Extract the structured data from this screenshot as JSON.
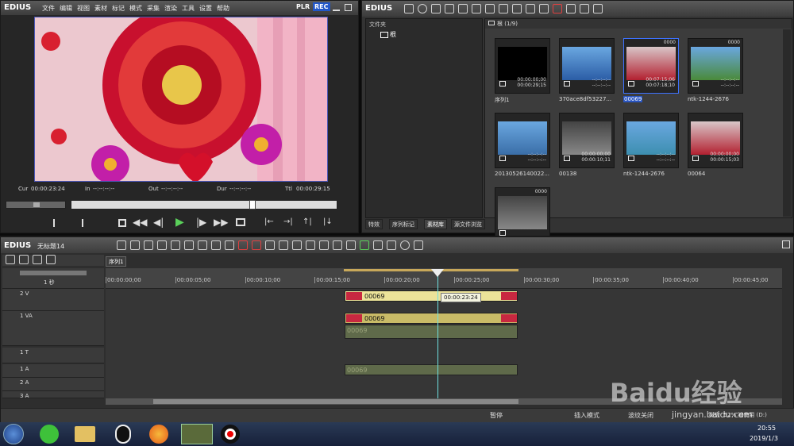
{
  "player": {
    "brand": "EDIUS",
    "menu": [
      "文件",
      "编辑",
      "视图",
      "素材",
      "标记",
      "模式",
      "采集",
      "渲染",
      "工具",
      "设置",
      "帮助"
    ],
    "plr": "PLR",
    "rec": "REC",
    "cur_label": "Cur",
    "cur_value": "00:00:23:24",
    "in_label": "In",
    "in_value": "--:--:--:--",
    "out_label": "Out",
    "out_value": "--:--:--:--",
    "dur_label": "Dur",
    "dur_value": "--:--:--:--",
    "ttl_label": "Ttl",
    "ttl_value": "00:00:29:15",
    "scrub_position": 0.68
  },
  "bin": {
    "brand": "EDIUS",
    "folder_header": "文件夹",
    "root_label": "根",
    "path_label": "根 (1/9)",
    "clips": [
      {
        "name": "序列1",
        "tc1": "00:00:00;00",
        "tc2": "00:00:29;15",
        "type": "sequence",
        "selected": false,
        "badge": ""
      },
      {
        "name": "370ace8df53227...",
        "tc1": "--:--:--:--",
        "tc2": "--:--:--:--",
        "type": "photo",
        "selected": false,
        "badge": ""
      },
      {
        "name": "00069",
        "tc1": "00:07:15;06",
        "tc2": "00:07:18;10",
        "type": "video",
        "selected": true,
        "badge": "0000"
      },
      {
        "name": "ntk-1244-2676",
        "tc1": "--:--:--:--",
        "tc2": "--:--:--:--",
        "type": "photo",
        "selected": false,
        "badge": "0000"
      },
      {
        "name": "20130526140022...",
        "tc1": "--:--:--:--",
        "tc2": "--:--:--:--",
        "type": "photo",
        "selected": false,
        "badge": ""
      },
      {
        "name": "00138",
        "tc1": "00:00:00;00",
        "tc2": "00:00:10;11",
        "type": "video",
        "selected": false,
        "badge": ""
      },
      {
        "name": "ntk-1244-2676",
        "tc1": "--:--:--:--",
        "tc2": "--:--:--:--",
        "type": "video",
        "selected": false,
        "badge": ""
      },
      {
        "name": "00064",
        "tc1": "00:00:00;00",
        "tc2": "00:00:15;03",
        "type": "video",
        "selected": false,
        "badge": ""
      },
      {
        "name": "",
        "tc1": "",
        "tc2": "",
        "type": "video",
        "selected": false,
        "badge": "0000"
      }
    ],
    "tabs": [
      "特效",
      "序列标记",
      "素材库",
      "源文件浏览"
    ]
  },
  "timeline": {
    "brand": "EDIUS",
    "project_name": "无标题14",
    "sequence_tab": "序列1",
    "zoom_label": "1 秒",
    "ruler": [
      "00:00:00;00",
      "00:00:05;00",
      "00:00:10;00",
      "00:00:15;00",
      "00:00:20;00",
      "00:00:25;00",
      "00:00:30;00",
      "00:00:35;00",
      "00:00:40;00",
      "00:00:45;00"
    ],
    "tracks": [
      {
        "name": "2 V"
      },
      {
        "name": "1 VA"
      },
      {
        "name": "1 T"
      },
      {
        "name": "1 A"
      },
      {
        "name": "2 A"
      },
      {
        "name": "3 A"
      }
    ],
    "clip_label": "00069",
    "playhead_tc": "00:00:23:24",
    "playhead_seconds": 23.8
  },
  "status": {
    "pause": "暂停",
    "insert_mode": "插入模式",
    "ripple_off": "波纹关闭",
    "disk": "磁盘: 52% 被使用 (D:)"
  },
  "taskbar": {
    "time": "20:55",
    "date": "2019/1/3"
  },
  "watermark": {
    "logo": "Baidu经验",
    "url": "jingyan.baidu.com"
  },
  "colors": {
    "accent_blue": "#1c4fb8",
    "clip_yellow": "#e9de8f",
    "rec_blue": "#2257c8"
  }
}
